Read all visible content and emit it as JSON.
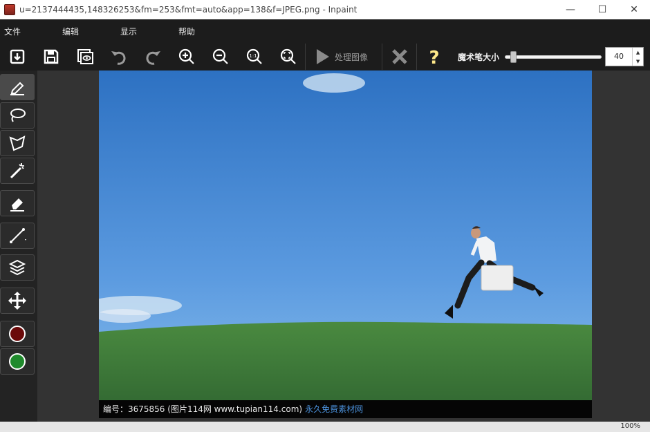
{
  "window": {
    "title": "u=2137444435,148326253&fm=253&fmt=auto&app=138&f=JPEG.png - Inpaint",
    "minimize": "—",
    "maximize": "☐",
    "close": "✕"
  },
  "menu": {
    "file": "文件",
    "edit": "编辑",
    "view": "显示",
    "help": "帮助"
  },
  "toolbar": {
    "process_label": "处理图像",
    "brush_size_label": "魔术笔大小",
    "brush_size_value": "40",
    "brush_size_fraction": 0.06
  },
  "tools": {
    "primary_color": "#6b0a0a",
    "secondary_color": "#1f8a2c"
  },
  "canvas": {
    "caption_text": "编号：3675856 (图片114网 www.tupian114.com)",
    "caption_brand": "永久免费素材网"
  },
  "status": {
    "zoom": "100%"
  },
  "colors": {
    "accent_yellow": "#ffe98a",
    "sky_top": "#2f74c4",
    "grass": "#3f7a38"
  }
}
